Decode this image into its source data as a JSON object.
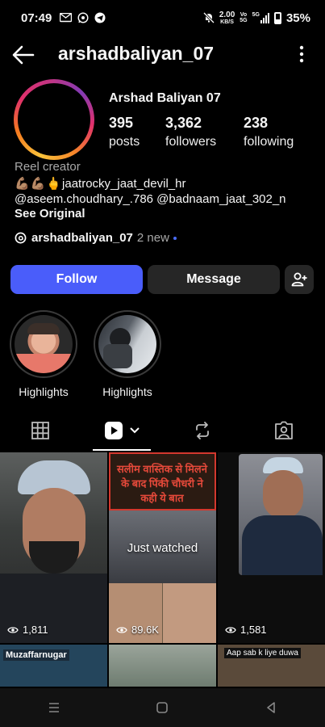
{
  "status": {
    "time": "07:49",
    "net_speed": "2.00",
    "net_unit": "KB/S",
    "volte": "Vo",
    "volte_sub": "5G",
    "net_type": "5G",
    "battery": "35%"
  },
  "header": {
    "username": "arshadbaliyan_07"
  },
  "profile": {
    "full_name": "Arshad Baliyan 07",
    "stats": [
      {
        "value": "395",
        "label": "posts"
      },
      {
        "value": "3,362",
        "label": "followers"
      },
      {
        "value": "238",
        "label": "following"
      }
    ],
    "category": "Reel creator",
    "bio_emoji": "💪🏽💪🏽🖕",
    "bio_line1": "jaatrocky_jaat_devil_hr",
    "bio_line2": "@aseem.choudhary_.786 @badnaam_jaat_302_n",
    "see_original": "See Original",
    "threads_name": "arshadbaliyan_07",
    "threads_new": "2 new"
  },
  "actions": {
    "follow": "Follow",
    "message": "Message"
  },
  "highlights": [
    {
      "label": "Highlights"
    },
    {
      "label": "Highlights"
    }
  ],
  "reels": [
    {
      "views": "1,811"
    },
    {
      "views": "89.6K",
      "overlay_top": "सलीम वास्तिक से मिलने के बाद पिंकी चौधरी ने कही ये बात",
      "badge": "Just watched"
    },
    {
      "views": "1,581"
    }
  ],
  "bottom_row": [
    {
      "text": "Muzaffarnugar"
    },
    {
      "text": ""
    },
    {
      "text": "Aap sab k liye duwa"
    }
  ],
  "colors": {
    "follow": "#4a5dfa",
    "secondary_button": "#262626",
    "background": "#000000"
  }
}
